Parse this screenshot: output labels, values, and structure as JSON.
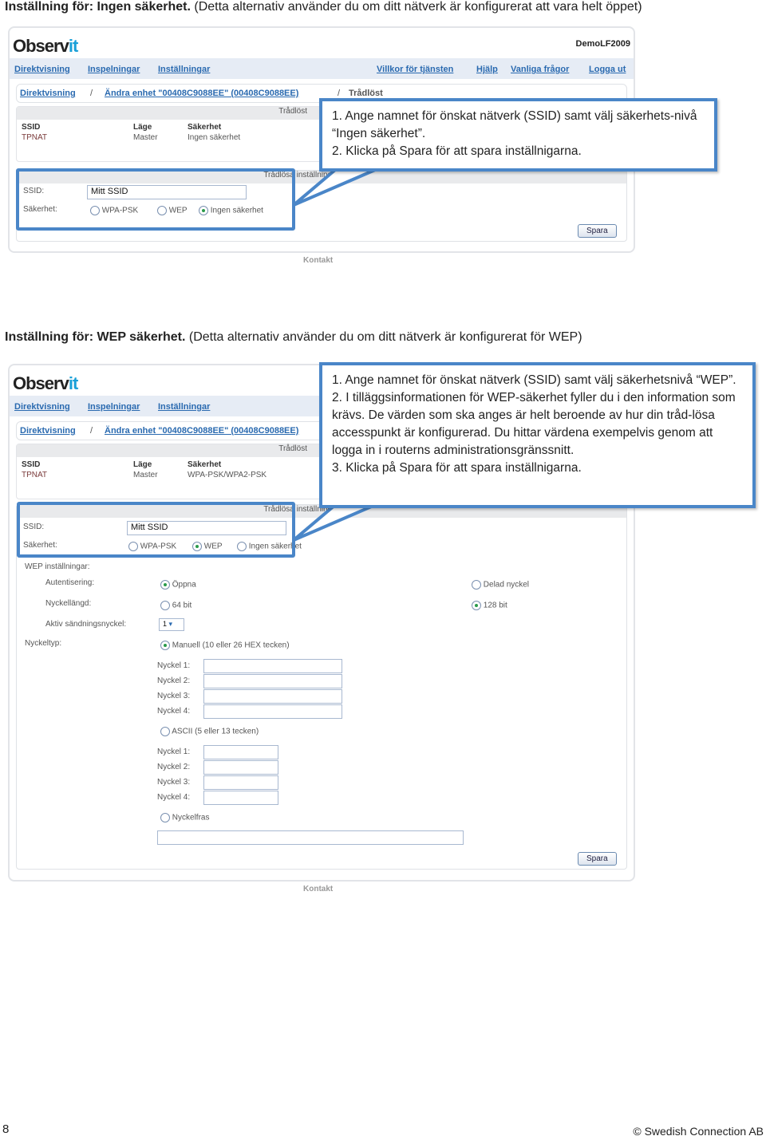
{
  "section1": {
    "heading_bold": "Inställning för: Ingen säkerhet.",
    "heading_rest": " (Detta alternativ använder du om ditt nätverk är konfigurerat att vara helt öppet)",
    "callout": [
      "1. Ange namnet för önskat nätverk (SSID) samt välj säkerhets-nivå “Ingen säkerhet”.",
      "2. Klicka på Spara för att spara inställnigarna."
    ],
    "security_value": "Ingen säkerhet"
  },
  "section2": {
    "heading_bold": "Inställning för: WEP säkerhet.",
    "heading_rest": " (Detta alternativ använder du om ditt nätverk är konfigurerat för WEP)",
    "callout": [
      "1. Ange namnet för önskat nätverk (SSID) samt välj säkerhetsnivå “WEP”.",
      "2. I tilläggsinformationen för WEP-säkerhet fyller du i den information som krävs. De värden som ska anges är helt beroende av hur din tråd-lösa accesspunkt är konfigurerad. Du hittar värdena exempelvis genom att logga in i routerns administrationsgränssnitt.",
      "3. Klicka på Spara för att spara inställnigarna."
    ],
    "security_value": "WPA-PSK/WPA2-PSK"
  },
  "app": {
    "logo": "Observ",
    "logo_accent": "it",
    "user": "DemoLF2009",
    "nav_left": [
      "Direktvisning",
      "Inspelningar",
      "Inställningar"
    ],
    "nav_right": [
      "Villkor för tjänsten",
      "Hjälp",
      "Vanliga frågor",
      "Logga ut"
    ],
    "breadcrumb": [
      "Direktvisning",
      "/",
      "Ändra enhet \"00408C9088EE\" (00408C9088EE)",
      "/",
      "Trådlöst"
    ],
    "table_title": "Trådlöst",
    "cols": [
      "SSID",
      "Läge",
      "Säkerhet"
    ],
    "ssid": "TPNAT",
    "mode": "Master",
    "form_title": "Trådlösa inställningar",
    "ssid_label": "SSID:",
    "ssid_value": "Mitt SSID",
    "security_label": "Säkerhet:",
    "sec_options": [
      "WPA-PSK",
      "WEP",
      "Ingen säkerhet"
    ],
    "save": "Spara",
    "contact": "Kontakt"
  },
  "wep": {
    "title": "WEP inställningar:",
    "auth_label": "Autentisering:",
    "auth_open": "Öppna",
    "auth_shared": "Delad nyckel",
    "len_label": "Nyckellängd:",
    "len_64": "64 bit",
    "len_128": "128 bit",
    "active_label": "Aktiv sändningsnyckel:",
    "active_value": "1",
    "type_label": "Nyckeltyp:",
    "manual": "Manuell (10 eller 26 HEX tecken)",
    "ascii": "ASCII (5 eller 13 tecken)",
    "passphrase": "Nyckelfras",
    "keys": [
      "Nyckel 1:",
      "Nyckel 2:",
      "Nyckel 3:",
      "Nyckel 4:"
    ]
  },
  "footer": {
    "page": "8",
    "copyright": "© Swedish Connection AB"
  },
  "colors": {
    "callout_border": "#4a86c8",
    "link": "#2a6ab0"
  }
}
